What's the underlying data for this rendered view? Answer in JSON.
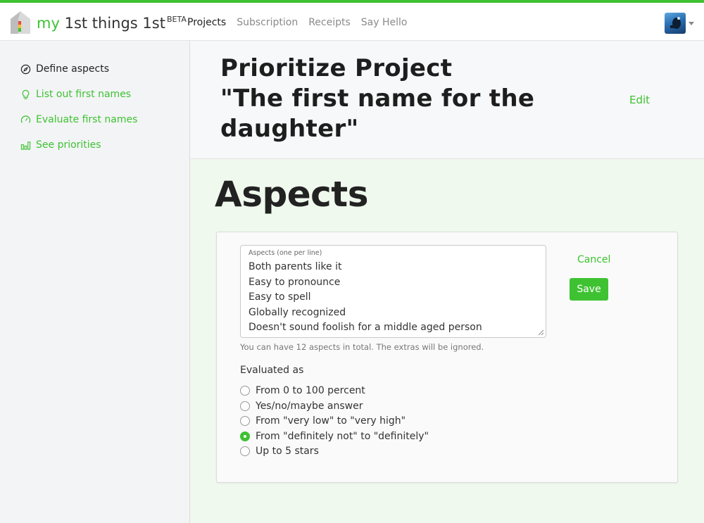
{
  "brand": {
    "my": "my",
    "rest": "1st things 1st",
    "beta": "BETA"
  },
  "nav": [
    {
      "label": "Projects",
      "active": true
    },
    {
      "label": "Subscription",
      "active": false
    },
    {
      "label": "Receipts",
      "active": false
    },
    {
      "label": "Say Hello",
      "active": false
    }
  ],
  "sidebar": {
    "items": [
      {
        "label": "Define aspects",
        "icon": "compass-icon"
      },
      {
        "label": "List out first names",
        "icon": "lightbulb-icon"
      },
      {
        "label": "Evaluate first names",
        "icon": "gauge-icon"
      },
      {
        "label": "See priorities",
        "icon": "bar-chart-icon"
      }
    ]
  },
  "header": {
    "title_line1": "Prioritize Project",
    "title_line2": "\"The first name for the daughter\"",
    "edit_label": "Edit"
  },
  "section": {
    "title": "Aspects"
  },
  "form": {
    "textarea_label": "Aspects (one per line)",
    "aspects": [
      "Both parents like it",
      "Easy to pronounce",
      "Easy to spell",
      "Globally recognized",
      "Doesn't sound foolish for a middle aged person"
    ],
    "helper": "You can have 12 aspects in total. The extras will be ignored.",
    "cancel_label": "Cancel",
    "save_label": "Save",
    "evaluated_label": "Evaluated as",
    "options": [
      {
        "label": "From 0 to 100 percent",
        "checked": false
      },
      {
        "label": "Yes/no/maybe answer",
        "checked": false
      },
      {
        "label": "From \"very low\" to \"very high\"",
        "checked": false
      },
      {
        "label": "From \"definitely not\" to \"definitely\"",
        "checked": true
      },
      {
        "label": "Up to 5 stars",
        "checked": false
      }
    ]
  },
  "colors": {
    "accent": "#3ec232",
    "content_bg": "#f0f9ee",
    "sidebar_bg": "#f3f4f6"
  }
}
